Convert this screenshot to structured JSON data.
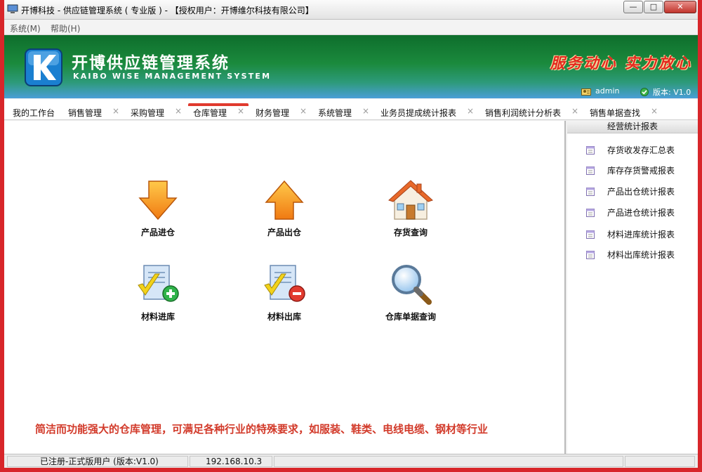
{
  "window": {
    "title": "开博科技 - 供应链管理系统 ( 专业版 )  - 【授权用户：开博维尔科技有限公司】",
    "minimize_glyph": "—",
    "maximize_glyph": "□",
    "close_glyph": "✕"
  },
  "menu": {
    "items": [
      {
        "label": "系统(M)"
      },
      {
        "label": "帮助(H)"
      }
    ]
  },
  "banner": {
    "logo_letter": "K",
    "title": "开博供应链管理系统",
    "subtitle": "KAIBO WISE MANAGEMENT SYSTEM",
    "slogan": "服务动心 实力放心",
    "user": "admin",
    "version": "版本: V1.0"
  },
  "tabs": [
    {
      "label": "我的工作台",
      "closable": false
    },
    {
      "label": "销售管理",
      "closable": true
    },
    {
      "label": "采购管理",
      "closable": true
    },
    {
      "label": "仓库管理",
      "closable": true,
      "active": true
    },
    {
      "label": "财务管理",
      "closable": true
    },
    {
      "label": "系统管理",
      "closable": true
    },
    {
      "label": "业务员提成统计报表",
      "closable": true
    },
    {
      "label": "销售利润统计分析表",
      "closable": true
    },
    {
      "label": "销售单据查找",
      "closable": true
    }
  ],
  "tab_close_glyph": "×",
  "tiles": [
    {
      "label": "产品进仓",
      "icon": "arrow-down-icon"
    },
    {
      "label": "产品出仓",
      "icon": "arrow-up-icon"
    },
    {
      "label": "存货查询",
      "icon": "house-icon"
    },
    {
      "label": "材料进库",
      "icon": "document-add-icon"
    },
    {
      "label": "材料出库",
      "icon": "document-remove-icon"
    },
    {
      "label": "仓库单据查询",
      "icon": "magnifier-icon"
    }
  ],
  "promo": "简洁而功能强大的仓库管理，可满足各种行业的特殊要求，如服装、鞋类、电线电缆、钢材等行业",
  "side_panel": {
    "title": "经营统计报表",
    "items": [
      {
        "label": "存货收发存汇总表"
      },
      {
        "label": "库存存货警戒报表"
      },
      {
        "label": "产品出仓统计报表"
      },
      {
        "label": "产品进仓统计报表"
      },
      {
        "label": "材料进库统计报表"
      },
      {
        "label": "材料出库统计报表"
      }
    ]
  },
  "status": {
    "registration": "已注册-正式版用户 (版本:V1.0)",
    "ip": "192.168.10.3"
  },
  "colors": {
    "accent_red": "#e03a2e",
    "banner_green": "#1b8a3d",
    "promo_red": "#d23a2a"
  }
}
